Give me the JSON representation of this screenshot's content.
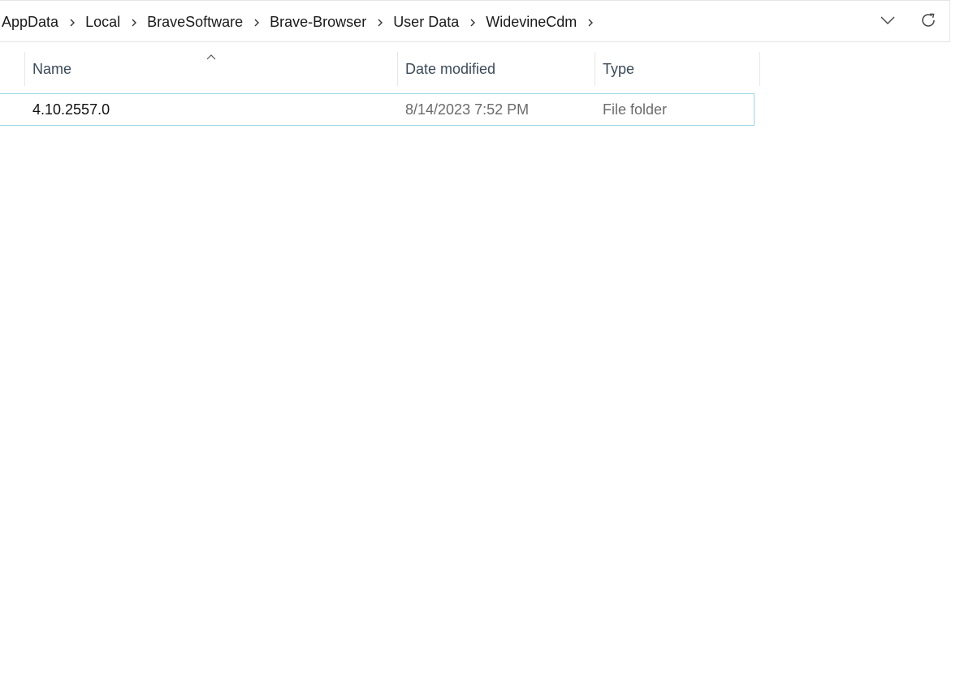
{
  "breadcrumb": {
    "items": [
      {
        "label": "AppData"
      },
      {
        "label": "Local"
      },
      {
        "label": "BraveSoftware"
      },
      {
        "label": "Brave-Browser"
      },
      {
        "label": "User Data"
      },
      {
        "label": "WidevineCdm"
      }
    ]
  },
  "address_bar": {
    "dropdown_icon": "chevron-down-icon",
    "refresh_icon": "refresh-icon"
  },
  "columns": {
    "name": "Name",
    "date_modified": "Date modified",
    "type": "Type",
    "sort_column": "Name",
    "sort_direction": "ascending"
  },
  "rows": [
    {
      "name": "4.10.2557.0",
      "date_modified": "8/14/2023 7:52 PM",
      "type": "File folder"
    }
  ],
  "colors": {
    "selection_border": "#99d8e6",
    "header_text": "#3b4a5a",
    "secondary_text": "#6b6b6b"
  }
}
